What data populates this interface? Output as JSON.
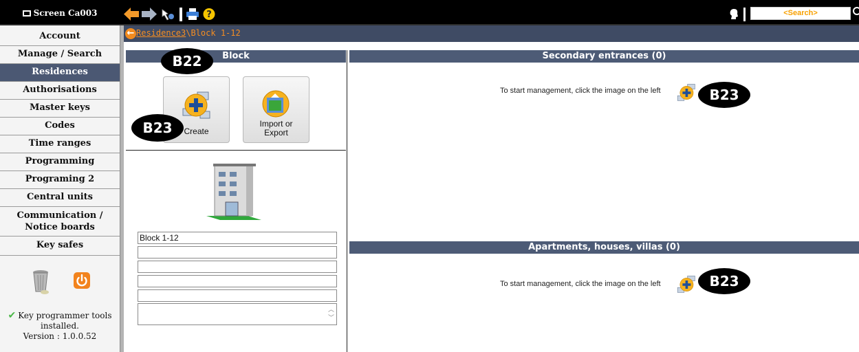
{
  "topbar": {
    "screen_title": "Screen Ca003",
    "search_placeholder": "<Search>"
  },
  "sidebar": {
    "items": [
      {
        "label": "Account",
        "active": false
      },
      {
        "label": "Manage / Search",
        "active": false
      },
      {
        "label": "Residences",
        "active": true
      },
      {
        "label": "Authorisations",
        "active": false
      },
      {
        "label": "Master keys",
        "active": false
      },
      {
        "label": "Codes",
        "active": false
      },
      {
        "label": "Time ranges",
        "active": false
      },
      {
        "label": "Programming",
        "active": false
      },
      {
        "label": "Programing 2",
        "active": false
      },
      {
        "label": "Central units",
        "active": false
      },
      {
        "label": "Communication / Notice boards",
        "active": false
      },
      {
        "label": "Key safes",
        "active": false
      }
    ],
    "status_line1": "Key programmer tools",
    "status_line2": "installed.",
    "version": "Version : 1.0.0.52"
  },
  "breadcrumb": {
    "residence": "Residence3",
    "block": "\\Block 1-12"
  },
  "block_panel": {
    "title": "Block",
    "create_label": "Create",
    "import_line1": "Import or",
    "import_line2": "Export",
    "block_name": "Block 1-12"
  },
  "secondary_panel": {
    "title": "Secondary entrances (0)",
    "hint": "To start management, click the image on the left"
  },
  "apartments_panel": {
    "title": "Apartments, houses, villas (0)",
    "hint": "To start management, click the image on the left"
  },
  "callouts": {
    "block_title": "B22",
    "create": "B23",
    "secondary_add": "B23",
    "apartments_add": "B23"
  },
  "colors": {
    "nav_active": "#4b5873",
    "panel_header": "#4d5b76",
    "accent_orange": "#f58e22",
    "search_text": "#f7a000"
  }
}
